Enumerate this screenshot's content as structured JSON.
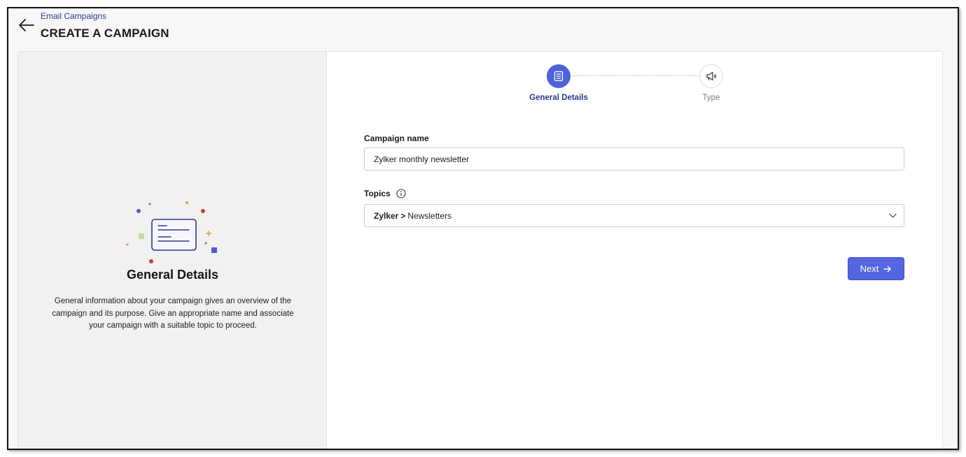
{
  "header": {
    "breadcrumb": "Email Campaigns",
    "title": "CREATE A CAMPAIGN",
    "back_icon": "arrow-left-icon"
  },
  "left_panel": {
    "title": "General Details",
    "description": "General information about your campaign gives an overview of the campaign and its purpose. Give an appropriate name and associate your campaign with a suitable topic to proceed.",
    "illustration_icon": "document-card-icon"
  },
  "stepper": {
    "steps": [
      {
        "label": "General Details",
        "icon": "list-document-icon",
        "active": true
      },
      {
        "label": "Type",
        "icon": "megaphone-icon",
        "active": false
      }
    ]
  },
  "form": {
    "campaign_name": {
      "label": "Campaign name",
      "value": "Zylker monthly newsletter"
    },
    "topics": {
      "label": "Topics",
      "info_icon": "info-icon",
      "selected_parent": "Zylker",
      "separator": ">",
      "selected_child": "Newsletters"
    },
    "next_label": "Next"
  },
  "colors": {
    "accent": "#5566e0",
    "step_active": "#4e63d8",
    "breadcrumb": "#2b3a8f",
    "panel_bg": "#f1f1f1"
  }
}
